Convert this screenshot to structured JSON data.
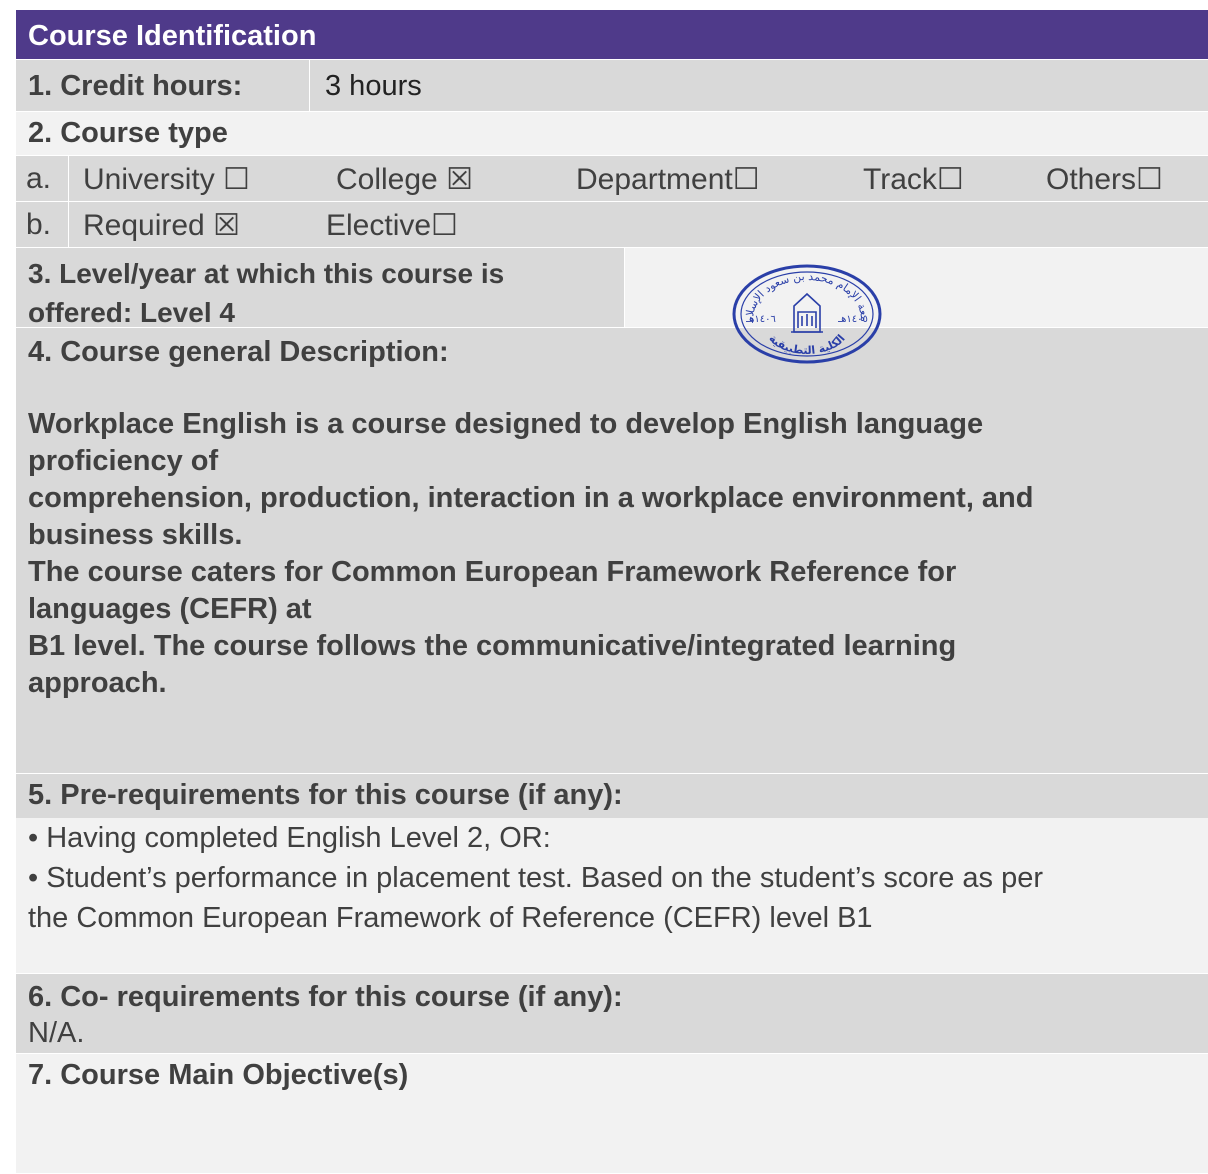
{
  "header": {
    "title": "Course Identification"
  },
  "credit": {
    "label": "1.  Credit hours:",
    "value": "3 hours"
  },
  "course_type": {
    "label": "2. Course type",
    "row_a": {
      "marker": "a.",
      "options": [
        "University ☐",
        "College ☒",
        "Department☐",
        "Track☐",
        "Others☐"
      ]
    },
    "row_b": {
      "marker": "b.",
      "options": [
        "Required ☒",
        "Elective☐"
      ]
    }
  },
  "level": {
    "line1": "3.  Level/year at which this course is",
    "line2": "offered: Level 4"
  },
  "description": {
    "label": "4. Course general Description:",
    "lines": [
      "Workplace English is a course designed to develop English language",
      "proficiency of",
      "comprehension, production, interaction in a workplace environment, and",
      "business skills.",
      "The course caters for Common European Framework Reference for",
      "languages (CEFR) at",
      "B1 level. The course follows the communicative/integrated learning",
      "approach."
    ]
  },
  "prereq": {
    "label": "5.  Pre-requirements for this course (if any):",
    "line1": "• Having completed English Level 2, OR:",
    "line2": "• Student’s performance in placement test. Based on the student’s score as per",
    "line3": "the Common European Framework of Reference (CEFR) level B1"
  },
  "coreq": {
    "label": "6.  Co- requirements for this course (if any):",
    "value": "N/A."
  },
  "objectives": {
    "label": "7. Course Main Objective(s)"
  },
  "stamp": {
    "top_text": "جامعة الإمام محمد بن سعود الإسلامية",
    "bottom_text": "الكلية التطبيقية",
    "left_year": "١٤٠٦هـ",
    "right_year": "١٤٠٥هـ"
  },
  "colors": {
    "header": "#4f3a8a",
    "dark_row": "#d9d9d9",
    "light_row": "#f2f2f2",
    "stamp_ink": "#2a3fa8"
  }
}
